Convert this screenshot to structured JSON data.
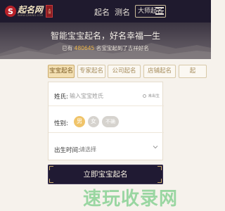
{
  "header": {
    "logo_mark": "S",
    "logo_name": "起名网",
    "logo_sub": "WWW.QIMING.COM",
    "logo_seal": "大师",
    "nav": [
      "起名",
      "测名"
    ],
    "master_label": "大师起名"
  },
  "hero": {
    "title": "智能宝宝起名，好名幸福一生",
    "sub_prefix": "已有",
    "sub_count": "480645",
    "sub_suffix": "名宝宝起到了吉祥好名"
  },
  "tabs": [
    "宝宝起名",
    "专家起名",
    "公司起名",
    "店铺起名",
    "起"
  ],
  "form": {
    "surname_label": "姓氏:",
    "surname_placeholder": "输入宝宝姓氏",
    "unborn_label": "未出生",
    "gender_label": "性别:",
    "gender_options": [
      "男",
      "女",
      "不确"
    ],
    "birth_label": "出生时间:",
    "birth_placeholder": "请选择"
  },
  "submit_label": "立即宝宝起名",
  "watermark": "速玩收录网",
  "colors": {
    "topbar": "#1f1a2e",
    "accent": "#f0c46a",
    "button": "#201a33",
    "tab_active": "#f3dfb2"
  }
}
